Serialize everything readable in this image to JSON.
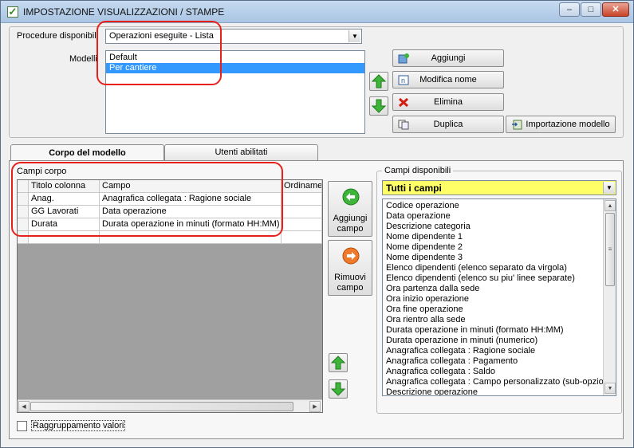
{
  "window": {
    "title": "IMPOSTAZIONE VISUALIZZAZIONI / STAMPE",
    "min": "–",
    "max": "□",
    "close": "✕"
  },
  "top": {
    "procedure_label": "Procedure disponibili",
    "procedure_value": "Operazioni eseguite - Lista",
    "modelli_label": "Modelli",
    "modelli": [
      "Default",
      "Per cantiere"
    ],
    "selected_modello": "Per cantiere",
    "buttons": {
      "aggiungi": "Aggiungi",
      "modifica_nome": "Modifica nome",
      "elimina": "Elimina",
      "duplica": "Duplica",
      "importazione": "Importazione modello"
    }
  },
  "tabs": [
    "Corpo del modello",
    "Utenti abilitati"
  ],
  "campi_corpo": {
    "label": "Campi corpo",
    "columns": [
      "Titolo colonna",
      "Campo",
      "Ordinamer"
    ],
    "rows": [
      {
        "titolo": "Anag.",
        "campo": "Anagrafica collegata : Ragione sociale",
        "ord": ""
      },
      {
        "titolo": "GG Lavorati",
        "campo": "Data operazione",
        "ord": ""
      },
      {
        "titolo": "Durata",
        "campo": "Durata operazione in minuti (formato HH:MM)",
        "ord": ""
      },
      {
        "titolo": "",
        "campo": "",
        "ord": ""
      }
    ]
  },
  "middle": {
    "aggiungi_campo_1": "Aggiungi",
    "aggiungi_campo_2": "campo",
    "rimuovi_campo_1": "Rimuovi",
    "rimuovi_campo_2": "campo"
  },
  "campi_disponibili": {
    "label": "Campi disponibili",
    "filter_value": "Tutti i campi",
    "items": [
      "Codice operazione",
      "Data operazione",
      "Descrizione categoria",
      "Nome dipendente 1",
      "Nome dipendente 2",
      "Nome dipendente 3",
      "Elenco dipendenti (elenco separato da virgola)",
      "Elenco dipendenti (elenco su piu' linee separate)",
      "Ora partenza dalla sede",
      "Ora inizio operazione",
      "Ora fine operazione",
      "Ora rientro alla sede",
      "Durata operazione in minuti (formato HH:MM)",
      "Durata operazione in minuti (numerico)",
      "Anagrafica collegata : Ragione sociale",
      "Anagrafica collegata : Pagamento",
      "Anagrafica collegata : Saldo",
      "Anagrafica collegata : Campo personalizzato (sub-opzione",
      "Descrizione operazione"
    ]
  },
  "raggruppamento_label": "Raggruppamento valori",
  "colors": {
    "highlight": "#3399ff",
    "filter_bg": "#ffff66",
    "annotation": "#e8201a"
  }
}
